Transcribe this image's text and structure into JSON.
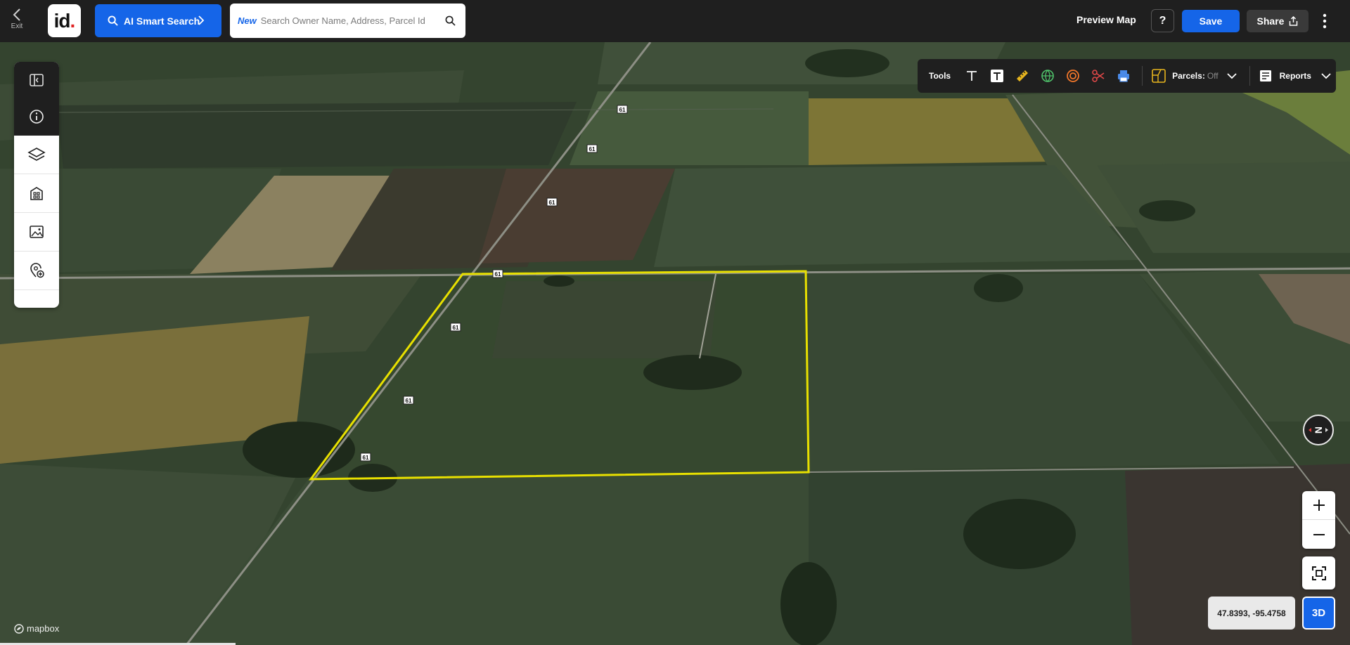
{
  "topbar": {
    "exit_label": "Exit",
    "logo_text": "id",
    "logo_dot": ".",
    "ai_search_label": "AI Smart Search",
    "search_badge": "New",
    "search_placeholder": "Search Owner Name, Address, Parcel Id",
    "preview_label": "Preview Map",
    "help_label": "?",
    "save_label": "Save",
    "share_label": "Share"
  },
  "tools_panel": {
    "title": "Tools",
    "parcels_label": "Parcels:",
    "parcels_state": "Off",
    "reports_label": "Reports",
    "icons": [
      "text-icon",
      "text-box-icon",
      "ruler-icon",
      "globe-measure-icon",
      "radius-icon",
      "scissors-icon",
      "print-icon"
    ]
  },
  "map": {
    "road_label": "61",
    "compass_label": "N",
    "coordinates": "47.8393, -95.4758",
    "mode_label": "3D",
    "attribution": "mapbox",
    "parcel_outline_color": "#e8e000"
  },
  "left_toolbar": {
    "icons": [
      "panel-toggle-icon",
      "info-icon",
      "layers-icon",
      "buildings-icon",
      "image-icon",
      "add-location-icon"
    ]
  },
  "colors": {
    "accent": "#1565e8",
    "toolbar_bg": "#1f1f1f"
  }
}
